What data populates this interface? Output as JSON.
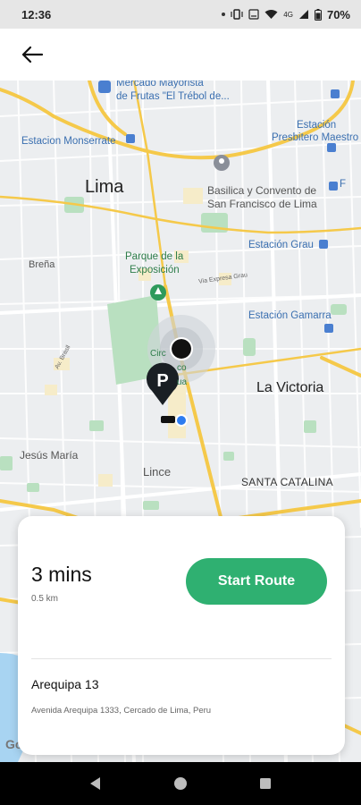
{
  "status_bar": {
    "time": "12:36",
    "network": "4G",
    "battery": "70%"
  },
  "header": {
    "back_icon": "arrow-left-icon"
  },
  "map": {
    "labels": {
      "lima": "Lima",
      "la_victoria": "La Victoria",
      "brena": "Breña",
      "jesus_maria": "Jesús María",
      "lince": "Lince",
      "santa_catalina": "SANTA CATALINA",
      "mercado_1": "Mercado Mayorista",
      "mercado_2": "de Frutas \"El Trébol de...",
      "estacion_monserrate": "Estacion Monserrate",
      "estacion_presbitero_1": "Estación",
      "estacion_presbitero_2": "Presbitero Maestro",
      "basilica_1": "Basilica y Convento de",
      "basilica_2": "San Francisco de Lima",
      "estacion_grau": "Estación Grau",
      "parque_1": "Parque de la",
      "parque_2": "Exposición",
      "via_expresa": "Via Expresa Grau",
      "estacion_gamarra": "Estación Gamarra",
      "circuito_1": "Circ",
      "circuito_2": "co",
      "circuito_3": "ua",
      "av_brasil": "Av. Brasil",
      "edge_f": "F"
    },
    "parking_marker": "P",
    "google": "Google"
  },
  "route_card": {
    "eta": "3 mins",
    "distance": "0.5 km",
    "start_label": "Start Route",
    "destination_name": "Arequipa 13",
    "destination_address": "Avenida Arequipa 1333, Cercado de Lima, Peru"
  },
  "colors": {
    "accent": "#2fb071",
    "road_major": "#f5c94a",
    "map_bg": "#eceef0",
    "park": "#b9e0c0",
    "water": "#a8d4f2"
  }
}
